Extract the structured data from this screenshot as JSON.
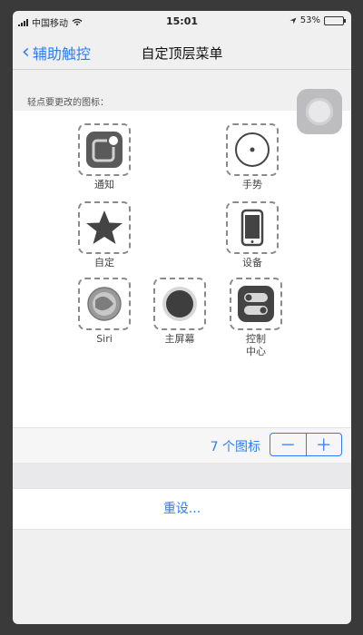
{
  "status_bar": {
    "carrier": "中国移动",
    "time": "15:01",
    "battery_percent": "53%",
    "battery_level": 0.53
  },
  "nav": {
    "back_label": "辅助触控",
    "title": "自定顶层菜单"
  },
  "hint": "轻点要更改的图标：",
  "icons": [
    {
      "label": "通知",
      "icon": "notification-icon"
    },
    {
      "label": "手势",
      "icon": "gesture-icon"
    },
    {
      "label": "自定",
      "icon": "star-icon"
    },
    {
      "label": "设备",
      "icon": "device-icon"
    },
    {
      "label": "Siri",
      "icon": "siri-icon"
    },
    {
      "label": "主屏幕",
      "icon": "home-icon"
    },
    {
      "label": "控制\n中心",
      "icon": "control-center-icon"
    }
  ],
  "footer": {
    "count_label": "7 个图标",
    "minus": "－",
    "plus": "＋"
  },
  "reset": {
    "label": "重设..."
  }
}
